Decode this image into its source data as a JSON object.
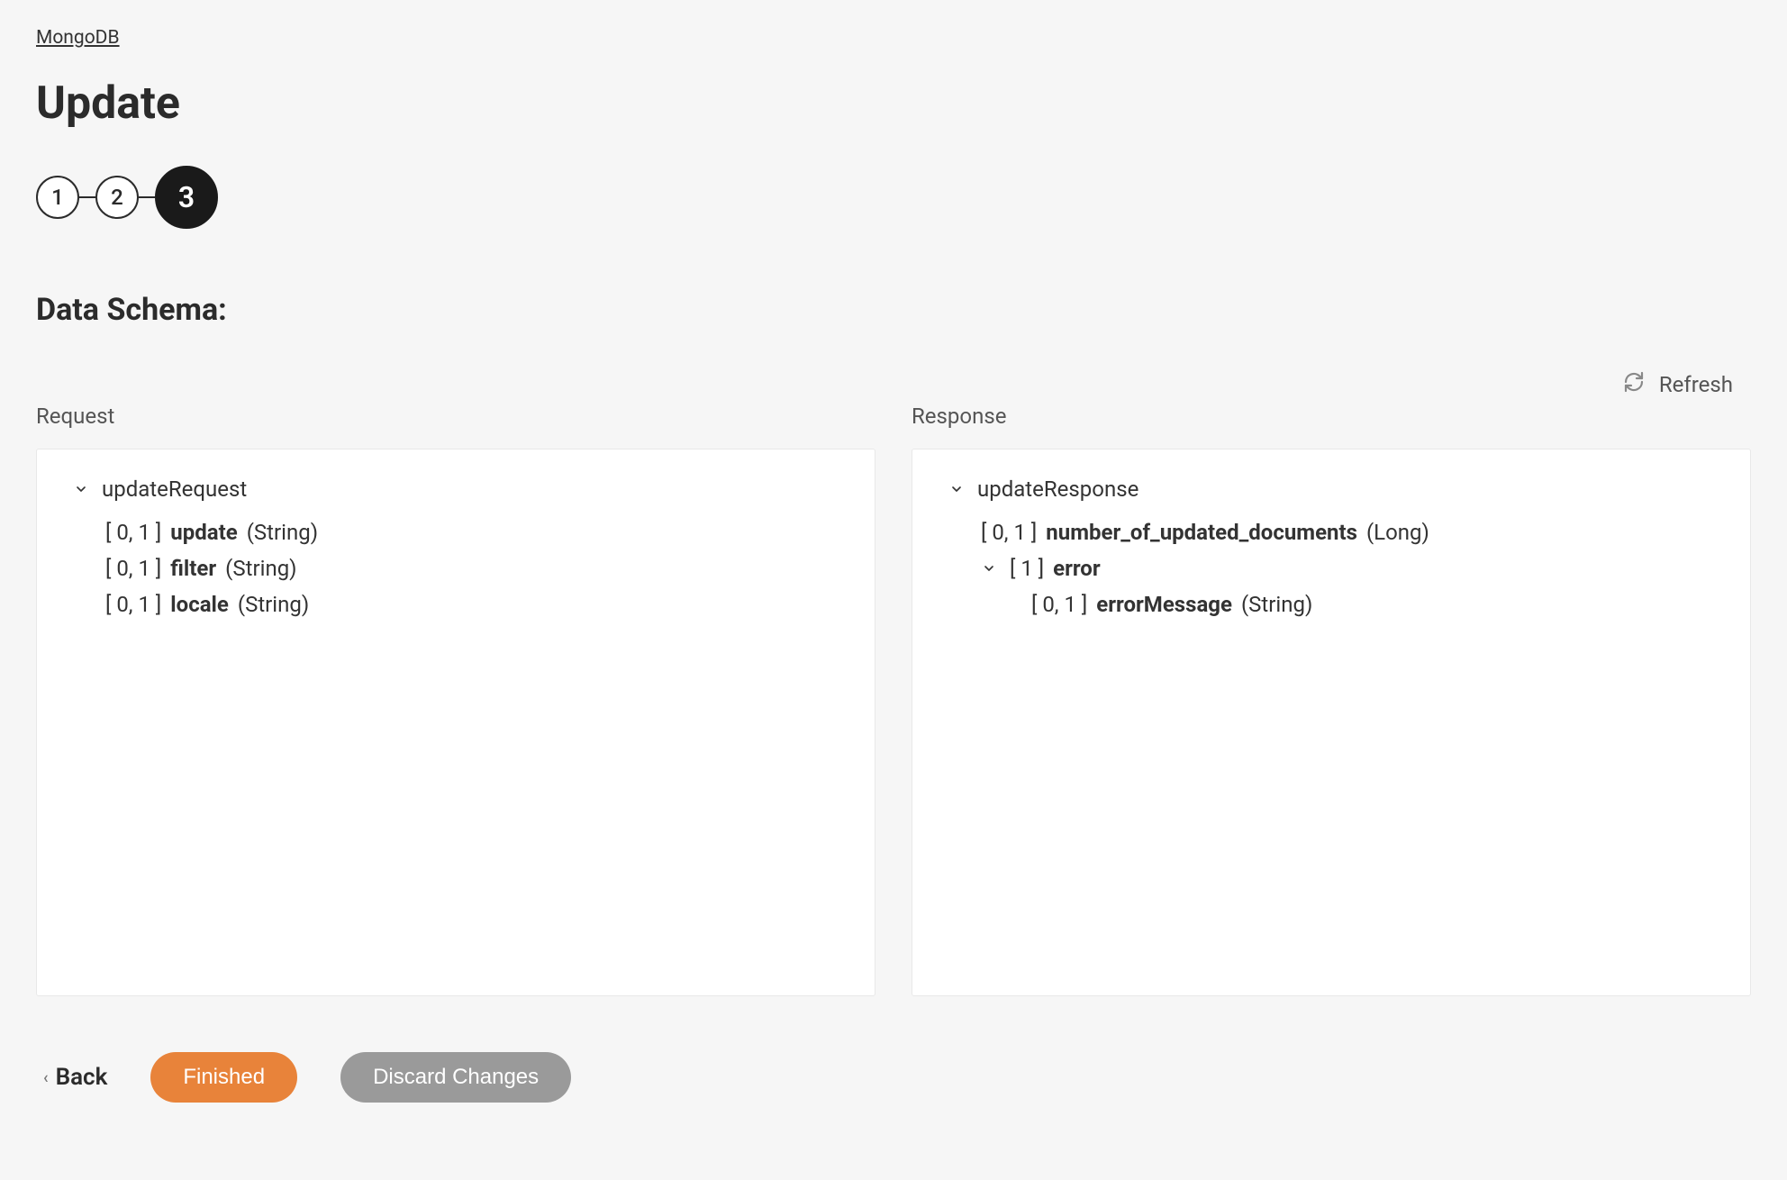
{
  "breadcrumb": "MongoDB",
  "page_title": "Update",
  "stepper": {
    "steps": [
      "1",
      "2",
      "3"
    ],
    "active_index": 2
  },
  "section_title": "Data Schema:",
  "refresh_label": "Refresh",
  "columns": {
    "request": {
      "header": "Request",
      "root": "updateRequest",
      "fields": [
        {
          "cardinality": "[ 0, 1 ]",
          "name": "update",
          "type": "(String)"
        },
        {
          "cardinality": "[ 0, 1 ]",
          "name": "filter",
          "type": "(String)"
        },
        {
          "cardinality": "[ 0, 1 ]",
          "name": "locale",
          "type": "(String)"
        }
      ]
    },
    "response": {
      "header": "Response",
      "root": "updateResponse",
      "fields": [
        {
          "cardinality": "[ 0, 1 ]",
          "name": "number_of_updated_documents",
          "type": "(Long)"
        }
      ],
      "error_group": {
        "cardinality": "[ 1 ]",
        "name": "error",
        "children": [
          {
            "cardinality": "[ 0, 1 ]",
            "name": "errorMessage",
            "type": "(String)"
          }
        ]
      }
    }
  },
  "footer": {
    "back": "Back",
    "finished": "Finished",
    "discard": "Discard Changes"
  }
}
